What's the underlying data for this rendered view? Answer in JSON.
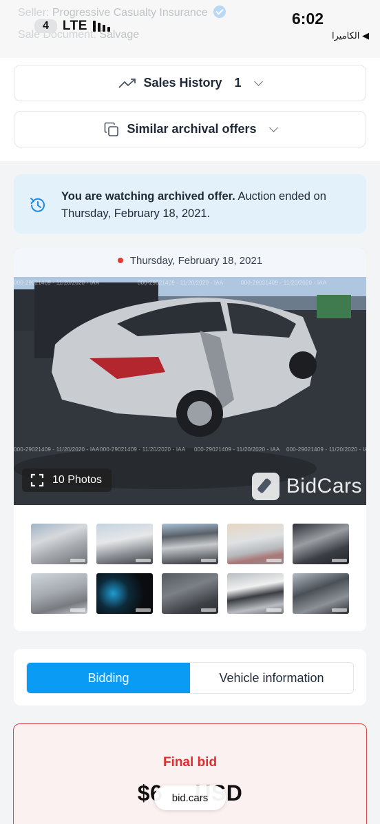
{
  "status_bar": {
    "carrier_badge": "4",
    "network": "LTE",
    "time": "6:02",
    "back_label": "◀ الكاميرا"
  },
  "seller": {
    "seller_key": "Seller:",
    "seller_value": "Progressive Casualty Insurance",
    "doc_key": "Sale Document:",
    "doc_value": "Salvage"
  },
  "sales_history": {
    "label": "Sales History",
    "count": "1"
  },
  "similar_offers": {
    "label": "Similar archival offers"
  },
  "notice": {
    "bold": "You are watching archived offer.",
    "text": " Auction ended on Thursday, February 18, 2021."
  },
  "gallery": {
    "date": "Thursday, February 18, 2021",
    "photos_count": "10 Photos",
    "watermark_brand": "BidCars",
    "watermark_text": "000-29021409 - 11/20/2020 - IAA"
  },
  "tabs": [
    {
      "label": "Bidding",
      "active": true
    },
    {
      "label": "Vehicle information",
      "active": false
    }
  ],
  "final_bid": {
    "label": "Final bid",
    "amount": "$6     USD"
  },
  "url_bar": {
    "domain": "bid.cars"
  },
  "colors": {
    "accent": "#0a9cf5",
    "final_bid_red": "#e12d2d",
    "notice_bg": "#e3f1fb"
  }
}
